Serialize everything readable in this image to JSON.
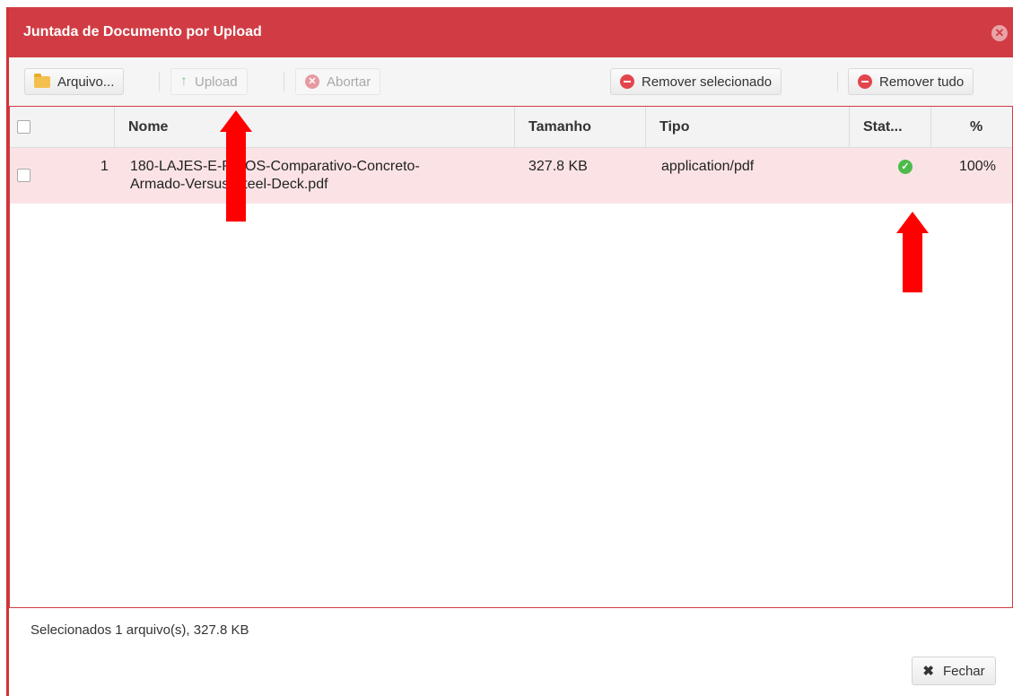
{
  "dialog": {
    "title": "Juntada de Documento por Upload",
    "close_icon": "close-circle-icon"
  },
  "toolbar": {
    "arquivo_label": "Arquivo...",
    "upload_label": "Upload",
    "abortar_label": "Abortar",
    "remover_selecionado_label": "Remover selecionado",
    "remover_tudo_label": "Remover tudo"
  },
  "table": {
    "columns": [
      "Nome",
      "Tamanho",
      "Tipo",
      "Stat...",
      "%"
    ],
    "rows": [
      {
        "index": "1",
        "name": "180-LAJES-E-PISOS-Comparativo-Concreto-Armado-Versus-Steel-Deck.pdf",
        "name_line1": "180-LAJES-E-PISOS-Comparativo-Concreto-",
        "name_line2": "Armado-Versus-Steel-Deck.pdf",
        "size": "327.8 KB",
        "type": "application/pdf",
        "status_icon": "check-circle-icon",
        "percent": "100%"
      }
    ]
  },
  "footer": {
    "summary": "Selecionados 1 arquivo(s), 327.8 KB",
    "fechar_label": "Fechar"
  },
  "colors": {
    "titlebar": "#d13c44",
    "selected_row": "#fbe3e5",
    "annotation_arrow": "#ff0000"
  }
}
